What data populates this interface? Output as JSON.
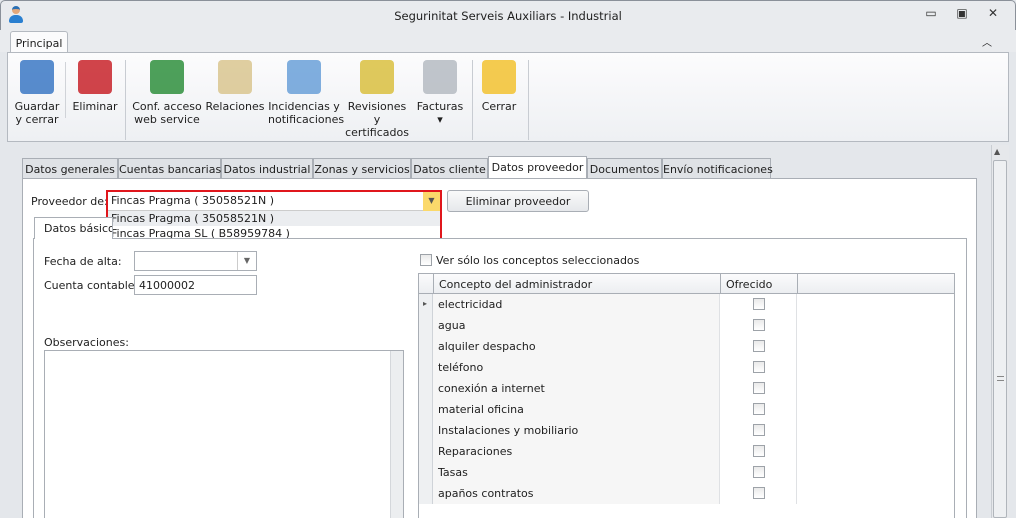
{
  "window": {
    "title": "Segurinitat Serveis Auxiliars - Industrial",
    "minimize_icon": "minimize-icon",
    "maximize_icon": "restore-icon",
    "close_icon": "close-icon"
  },
  "ribbon": {
    "tab": "Principal",
    "buttons": [
      {
        "id": "guardar",
        "label1": "Guardar",
        "label2": "y cerrar",
        "icon": "floppy-disk-icon"
      },
      {
        "id": "eliminar",
        "label1": "Eliminar",
        "label2": "",
        "icon": "red-x-icon"
      },
      {
        "id": "conf",
        "label1": "Conf. acceso",
        "label2": "web service",
        "icon": "globe-gear-icon"
      },
      {
        "id": "relaciones",
        "label1": "Relaciones",
        "label2": "",
        "icon": "id-cards-icon"
      },
      {
        "id": "incidencias",
        "label1": "Incidencias y",
        "label2": "notificaciones",
        "icon": "clipboard-check-icon"
      },
      {
        "id": "revisiones",
        "label1": "Revisiones y",
        "label2": "certificados",
        "icon": "notebook-bell-icon"
      },
      {
        "id": "facturas",
        "label1": "Facturas",
        "label2": "▾",
        "icon": "invoice-coins-icon"
      },
      {
        "id": "cerrar",
        "label1": "Cerrar",
        "label2": "",
        "icon": "folder-arrow-icon"
      }
    ]
  },
  "tabs": [
    "Datos generales",
    "Cuentas bancarias",
    "Datos industrial",
    "Zonas y servicios",
    "Datos cliente",
    "Datos proveedor",
    "Documentos",
    "Envío notificaciones"
  ],
  "active_tab": "Datos proveedor",
  "proveedor": {
    "label": "Proveedor de:",
    "value": "Fincas Pragma ( 35058521N )",
    "options": [
      "Fincas Pragma ( 35058521N )",
      "Fincas Pragma SL ( B58959784 )"
    ],
    "highlight_color": "#e0161c",
    "delete_button": "Eliminar proveedor"
  },
  "inner_tab": "Datos básicos",
  "form": {
    "fecha_alta_label": "Fecha de alta:",
    "fecha_alta_value": "",
    "cuenta_label": "Cuenta contable:",
    "cuenta_value": "41000002",
    "observaciones_label": "Observaciones:"
  },
  "grid": {
    "filter_label": "Ver sólo los conceptos seleccionados",
    "filter_checked": false,
    "columns": [
      "Concepto del administrador",
      "Ofrecido"
    ],
    "rows": [
      {
        "concepto": "electricidad",
        "ofrecido": false
      },
      {
        "concepto": "agua",
        "ofrecido": false
      },
      {
        "concepto": "alquiler despacho",
        "ofrecido": false
      },
      {
        "concepto": "teléfono",
        "ofrecido": false
      },
      {
        "concepto": "conexión a internet",
        "ofrecido": false
      },
      {
        "concepto": "material oficina",
        "ofrecido": false
      },
      {
        "concepto": "Instalaciones y mobiliario",
        "ofrecido": false
      },
      {
        "concepto": "Reparaciones",
        "ofrecido": false
      },
      {
        "concepto": "Tasas",
        "ofrecido": false
      },
      {
        "concepto": "apaños contratos",
        "ofrecido": false
      }
    ]
  }
}
